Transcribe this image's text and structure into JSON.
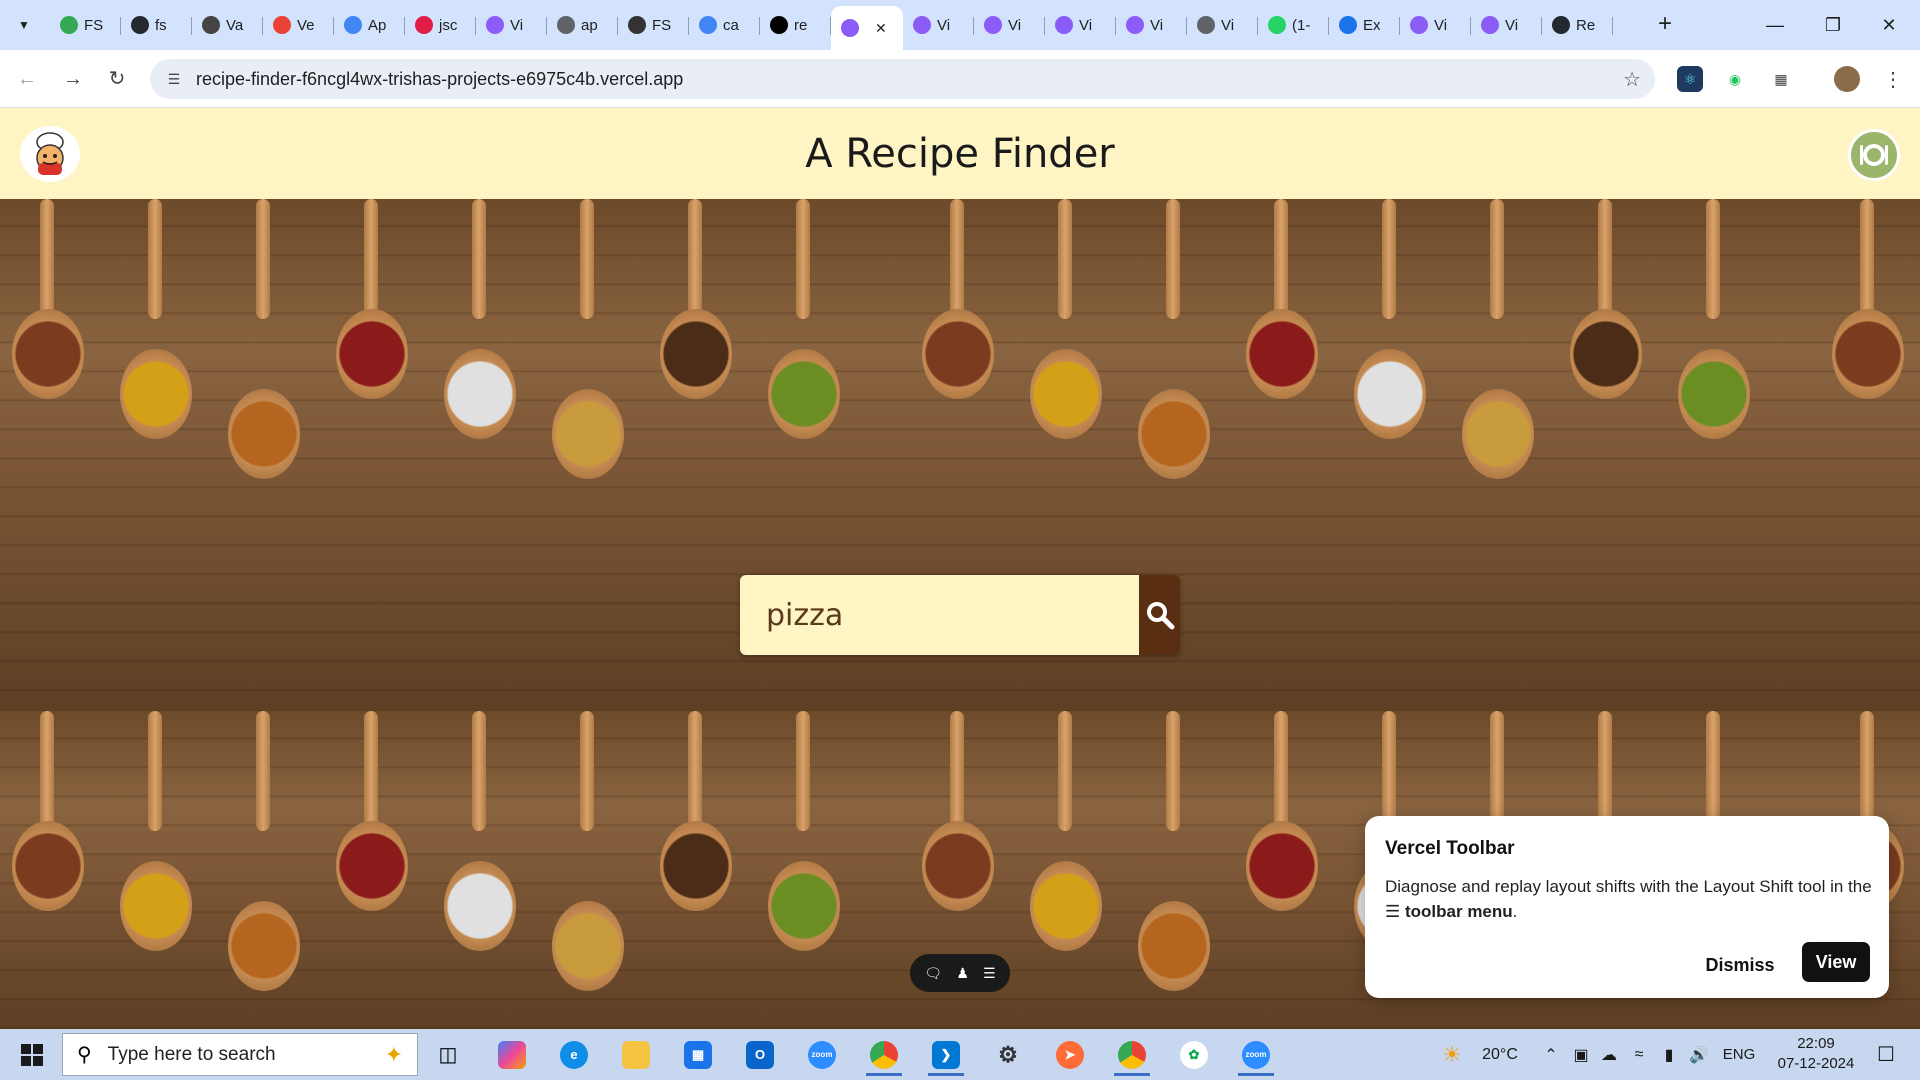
{
  "browser": {
    "tabs": [
      {
        "label": "FS",
        "icon": "google-icon",
        "color": "#34a853"
      },
      {
        "label": "fs",
        "icon": "github-icon",
        "color": "#24292f"
      },
      {
        "label": "Va",
        "icon": "openai-icon",
        "color": "#444444"
      },
      {
        "label": "Ve",
        "icon": "gmail-icon",
        "color": "#ea4335"
      },
      {
        "label": "Ap",
        "icon": "google-icon",
        "color": "#4285f4"
      },
      {
        "label": "jsc",
        "icon": "gfg-icon",
        "color": "#e11d48"
      },
      {
        "label": "Vi",
        "icon": "vite-icon",
        "color": "#8b5cf6"
      },
      {
        "label": "ap",
        "icon": "globe-icon",
        "color": "#5f6368"
      },
      {
        "label": "FS",
        "icon": "contact-icon",
        "color": "#333333"
      },
      {
        "label": "ca",
        "icon": "google-icon",
        "color": "#4285f4"
      },
      {
        "label": "re",
        "icon": "vercel-icon",
        "color": "#000000"
      },
      {
        "label": "",
        "icon": "vite-icon",
        "color": "#8b5cf6",
        "active": true
      },
      {
        "label": "Vi",
        "icon": "vite-icon",
        "color": "#8b5cf6"
      },
      {
        "label": "Vi",
        "icon": "vite-icon",
        "color": "#8b5cf6"
      },
      {
        "label": "Vi",
        "icon": "vite-icon",
        "color": "#8b5cf6"
      },
      {
        "label": "Vi",
        "icon": "vite-icon",
        "color": "#8b5cf6"
      },
      {
        "label": "Vi",
        "icon": "globe-icon",
        "color": "#5f6368"
      },
      {
        "label": "(1-",
        "icon": "whatsapp-icon",
        "color": "#25d366"
      },
      {
        "label": "Ex",
        "icon": "puzzle-icon",
        "color": "#1a73e8"
      },
      {
        "label": "Vi",
        "icon": "vite-icon",
        "color": "#8b5cf6"
      },
      {
        "label": "Vi",
        "icon": "vite-icon",
        "color": "#8b5cf6"
      },
      {
        "label": "Re",
        "icon": "github-icon",
        "color": "#24292f"
      }
    ],
    "url": "recipe-finder-f6ncgl4wx-trishas-projects-e6975c4b.vercel.app"
  },
  "app": {
    "title": "A Recipe Finder",
    "search": {
      "value": "pizza",
      "placeholder": ""
    }
  },
  "vercel_popup": {
    "title": "Vercel Toolbar",
    "body_prefix": "Diagnose and replay layout shifts with the Layout Shift tool in the",
    "body_bold": "toolbar menu",
    "body_suffix": ".",
    "dismiss_label": "Dismiss",
    "view_label": "View"
  },
  "taskbar": {
    "search_placeholder": "Type here to search",
    "weather": "20°C",
    "language": "ENG",
    "time": "22:09",
    "date": "07-12-2024"
  },
  "colors": {
    "header_bg": "#fff5c4",
    "search_button": "#5a2e10",
    "wood": "#7a5535"
  }
}
